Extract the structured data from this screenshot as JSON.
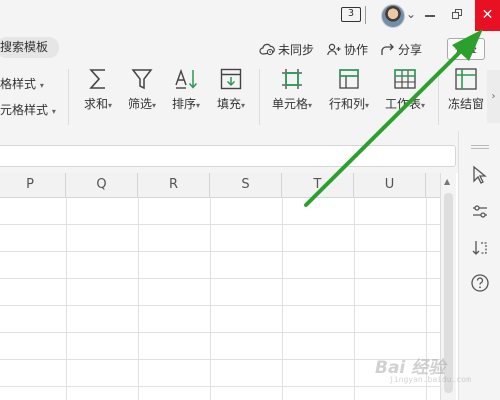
{
  "titlebar": {
    "badge": "3",
    "close_glyph": "✕"
  },
  "menurow": {
    "search_label": "搜索模板",
    "items": [
      {
        "label": "未同步",
        "icon": "cloud-icon"
      },
      {
        "label": "协作",
        "icon": "collaborate-icon"
      },
      {
        "label": "分享",
        "icon": "share-icon"
      }
    ],
    "collapse_label": "折叠"
  },
  "ribbon": {
    "left_small": [
      "格样式",
      "元格样式"
    ],
    "buttons": [
      {
        "label": "求和",
        "icon": "sum-icon"
      },
      {
        "label": "筛选",
        "icon": "filter-icon"
      },
      {
        "label": "排序",
        "icon": "sort-icon"
      },
      {
        "label": "填充",
        "icon": "fill-icon"
      },
      {
        "label": "单元格",
        "icon": "cell-icon"
      },
      {
        "label": "行和列",
        "icon": "row-col-icon"
      },
      {
        "label": "工作表",
        "icon": "worksheet-icon"
      },
      {
        "label": "冻结窗",
        "icon": "freeze-pane-icon"
      }
    ]
  },
  "grid": {
    "columns": [
      "P",
      "Q",
      "R",
      "S",
      "T",
      "U"
    ]
  },
  "watermark": {
    "text": "Bai 经验",
    "sub": "jingyan.baidu.com"
  },
  "colors": {
    "accent_close": "#e81123",
    "arrow": "#2ca02c"
  }
}
